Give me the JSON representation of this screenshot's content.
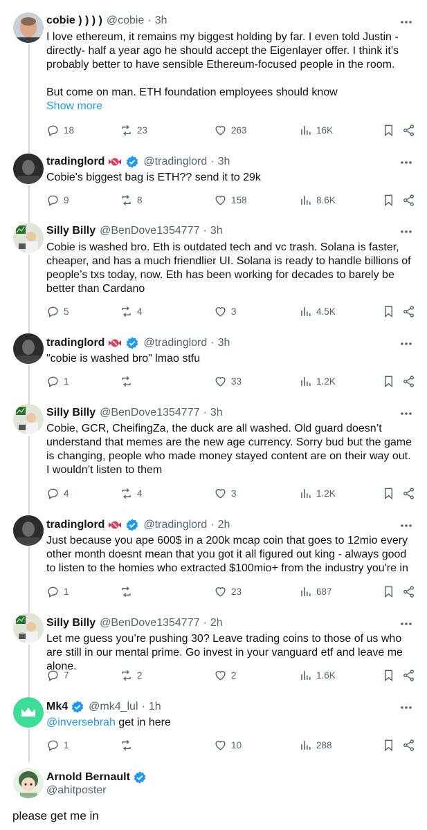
{
  "tweets": [
    {
      "name": "cobie ) ) ) )",
      "handle": "@cobie",
      "time": "3h",
      "text": "I love ethereum, it remains my biggest holding by far. I even told Justin - directly- half a year ago he should accept the Eigenlayer offer. I think it’s probably better to have sensible Ethereum-focused people in the room.",
      "text2": "But come on man. ETH foundation employees should know",
      "show_more": "Show more",
      "replies": "18",
      "reposts": "23",
      "likes": "263",
      "views": "16K"
    },
    {
      "name": "tradinglord",
      "handle": "@tradinglord",
      "time": "3h",
      "text": "Cobie's biggest bag is ETH?? send it to 29k",
      "replies": "9",
      "reposts": "8",
      "likes": "158",
      "views": "8.6K"
    },
    {
      "name": "Silly Billy",
      "handle": "@BenDove1354777",
      "time": "3h",
      "text": "Cobie is washed bro. Eth is outdated tech and vc trash. Solana is faster, cheaper, and has a much friendlier UI. Solana is ready to handle billions of people’s txs today, now. Eth has been working for decades to barely be better than Cardano",
      "replies": "5",
      "reposts": "4",
      "likes": "3",
      "views": "4.5K"
    },
    {
      "name": "tradinglord",
      "handle": "@tradinglord",
      "time": "3h",
      "text": "\"cobie is washed bro\" lmao stfu",
      "replies": "1",
      "reposts": "",
      "likes": "33",
      "views": "1.2K"
    },
    {
      "name": "Silly Billy",
      "handle": "@BenDove1354777",
      "time": "3h",
      "text": "Cobie, GCR, CheifingZa, the duck are all washed. Old guard doesn’t understand that memes are the new age currency. Sorry bud but the game is changing, people who made money stayed content are on their way out. I wouldn’t listen to them",
      "replies": "4",
      "reposts": "4",
      "likes": "3",
      "views": "1.2K"
    },
    {
      "name": "tradinglord",
      "handle": "@tradinglord",
      "time": "2h",
      "text": "Just because you ape 600$ in a 200k mcap coin that goes to 12mio every other month doesnt mean that you got it all figured out king - always good to listen to the homies who extracted $100mio+ from the industry you're in",
      "replies": "1",
      "reposts": "",
      "likes": "23",
      "views": "687"
    },
    {
      "name": "Silly Billy",
      "handle": "@BenDove1354777",
      "time": "2h",
      "text": "Let me guess you’re pushing 30? Leave trading coins to those of us who are still in our mental prime. Go invest in your vanguard etf and leave me alone.",
      "replies": "7",
      "reposts": "2",
      "likes": "2",
      "views": "1.6K"
    },
    {
      "name": "Mk4",
      "handle": "@mk4_lul",
      "time": "1h",
      "mention": "@inversebrah",
      "text": " get in here",
      "replies": "1",
      "reposts": "",
      "likes": "10",
      "views": "288"
    }
  ],
  "main_reply": {
    "name": "Arnold Bernault",
    "handle": "@ahitposter",
    "text": "please get me in"
  },
  "colors": {
    "accent": "#1d9bf0",
    "muted": "#536471",
    "text": "#0f1419",
    "line": "#cfd9de"
  }
}
